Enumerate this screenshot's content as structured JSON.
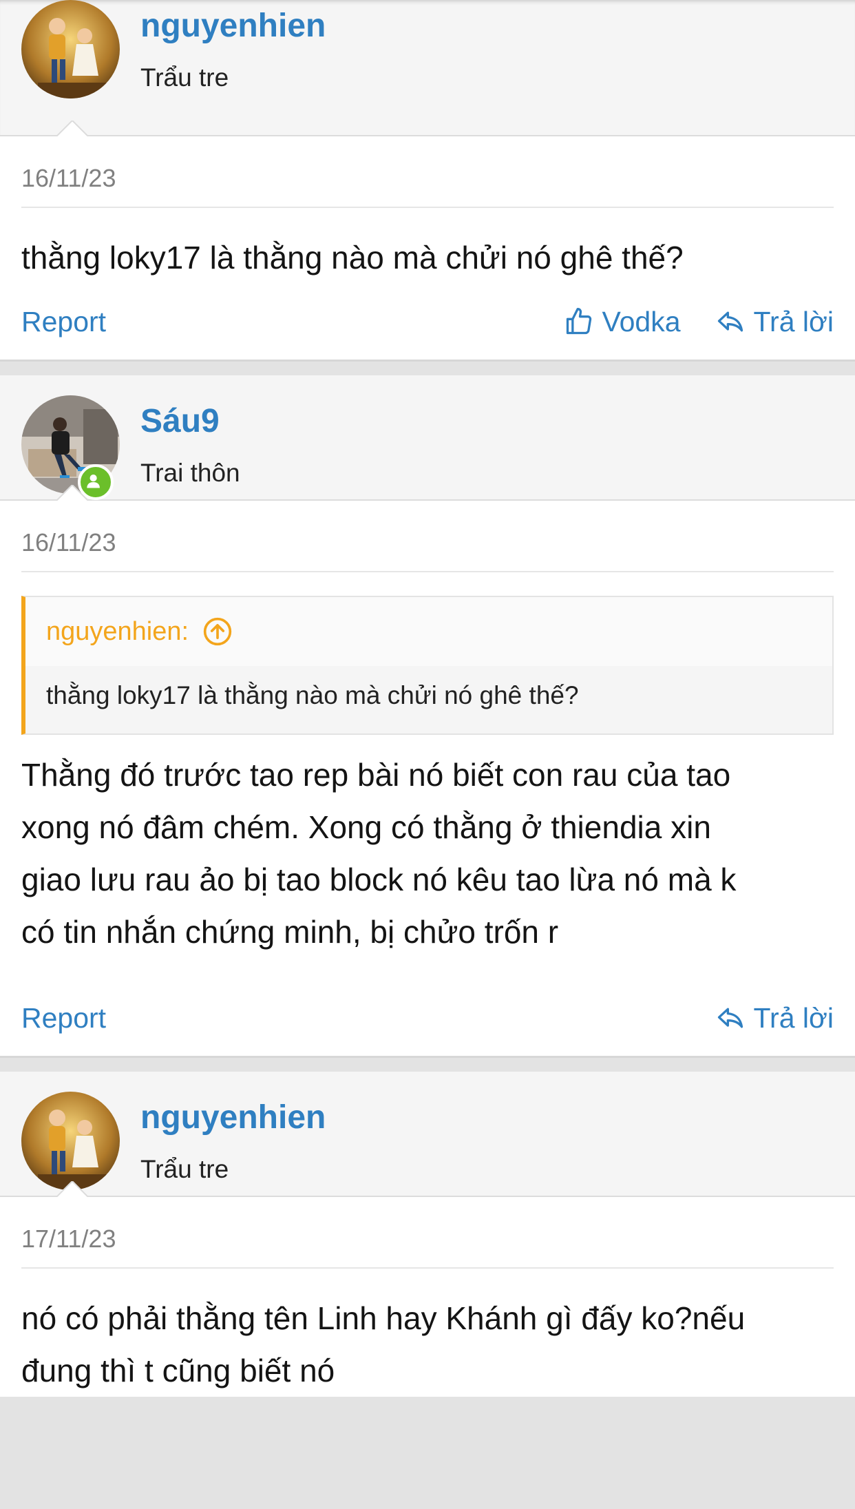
{
  "posts": [
    {
      "username": "nguyenhien",
      "user_title": "Trẩu tre",
      "date": "16/11/23",
      "text": "thằng loky17 là thằng nào mà chửi nó ghê thế?",
      "report_label": "Report",
      "like_label": "Vodka",
      "reply_label": "Trả lời"
    },
    {
      "username": "Sáu9",
      "user_title": "Trai thôn",
      "date": "16/11/23",
      "quote": {
        "author": "nguyenhien:",
        "text": "thằng loky17 là thằng nào mà chửi nó ghê thế?"
      },
      "text_lines": [
        "Thằng đó trước tao rep bài nó biết con rau của tao",
        "xong nó đâm chém. Xong có thằng ở thiendia xin",
        "giao lưu rau ảo bị tao block nó kêu tao lừa nó mà k",
        "có tin nhắn chứng minh, bị chửo trốn r"
      ],
      "report_label": "Report",
      "reply_label": "Trả lời"
    },
    {
      "username": "nguyenhien",
      "user_title": "Trẩu tre",
      "date": "17/11/23",
      "text_lines": [
        "nó có phải thằng tên Linh hay Khánh gì đấy ko?nếu",
        "đung thì t cũng biết nó"
      ]
    }
  ],
  "colors": {
    "link": "#2f7fc1",
    "quote_accent": "#f3a51c",
    "online": "#6bbf2a"
  }
}
